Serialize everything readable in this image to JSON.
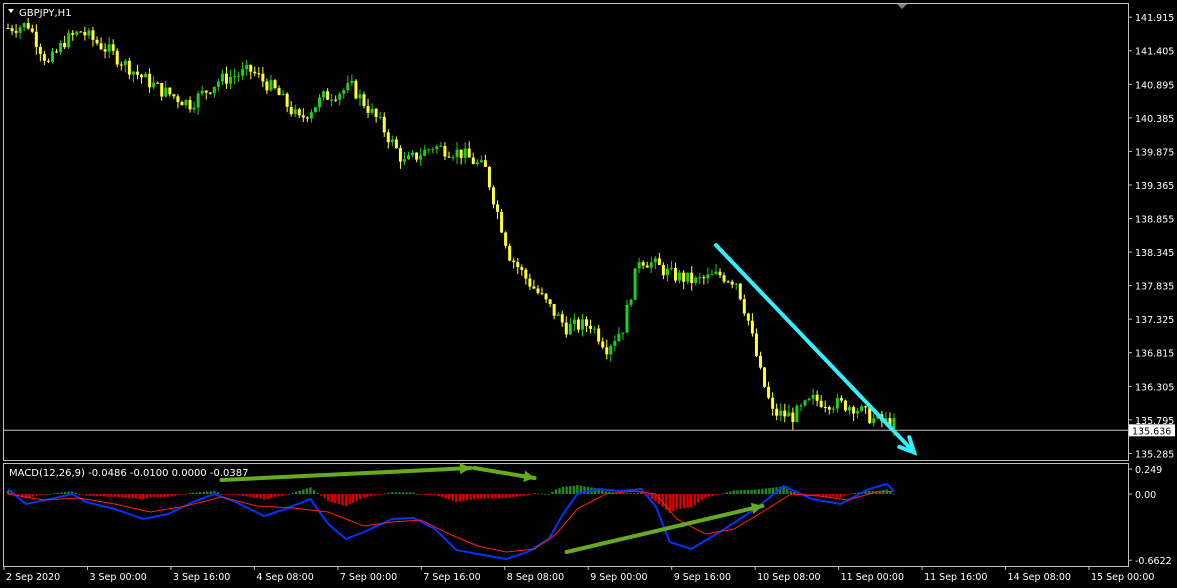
{
  "window": {
    "symbol_title": "GBPJPY,H1",
    "current_price_label": "135.636"
  },
  "colors": {
    "background": "#000000",
    "bull_candle": "#22cc22",
    "bear_candle": "#ffff33",
    "grid_frame": "#c0c0c0",
    "price_line": "#c0c0c0",
    "macd_line": "#0033ff",
    "signal_line": "#ff2200",
    "osma_positive": "#1f8a1f",
    "osma_negative": "#dd0000",
    "trend_arrow": "#33eeff",
    "divergence_arrows": "#66aa22"
  },
  "chart_data": [
    {
      "type": "candlestick",
      "symbol": "GBPJPY",
      "timeframe": "H1",
      "y_ticks": [
        "141.915",
        "141.405",
        "140.895",
        "140.385",
        "139.875",
        "139.365",
        "138.855",
        "138.345",
        "137.835",
        "137.325",
        "136.815",
        "136.305",
        "135.795",
        "135.285"
      ],
      "ylim": [
        135.2,
        142.1
      ],
      "last_price": 135.636,
      "x_ticks": [
        "2 Sep 2020",
        "3 Sep 00:00",
        "3 Sep 16:00",
        "4 Sep 08:00",
        "7 Sep 00:00",
        "7 Sep 16:00",
        "8 Sep 08:00",
        "9 Sep 00:00",
        "9 Sep 16:00",
        "10 Sep 08:00",
        "11 Sep 00:00",
        "11 Sep 16:00",
        "14 Sep 08:00",
        "15 Sep 00:00"
      ],
      "bar_count": 220,
      "close_path": [
        [
          0,
          141.75
        ],
        [
          5,
          141.8
        ],
        [
          10,
          141.2
        ],
        [
          14,
          141.55
        ],
        [
          18,
          141.7
        ],
        [
          25,
          141.4
        ],
        [
          32,
          141.05
        ],
        [
          38,
          140.8
        ],
        [
          45,
          140.6
        ],
        [
          52,
          140.95
        ],
        [
          60,
          141.1
        ],
        [
          66,
          140.8
        ],
        [
          72,
          140.35
        ],
        [
          78,
          140.7
        ],
        [
          85,
          140.85
        ],
        [
          92,
          140.3
        ],
        [
          98,
          139.7
        ],
        [
          105,
          139.95
        ],
        [
          112,
          139.85
        ],
        [
          118,
          139.6
        ],
        [
          124,
          138.3
        ],
        [
          128,
          137.95
        ],
        [
          132,
          137.65
        ],
        [
          138,
          137.2
        ],
        [
          144,
          137.25
        ],
        [
          148,
          136.9
        ],
        [
          152,
          137.2
        ],
        [
          156,
          138.25
        ],
        [
          160,
          138.15
        ],
        [
          164,
          138.0
        ],
        [
          170,
          137.9
        ],
        [
          176,
          138.0
        ],
        [
          180,
          137.9
        ],
        [
          183,
          137.3
        ],
        [
          186,
          136.5
        ],
        [
          189,
          135.9
        ],
        [
          194,
          135.85
        ],
        [
          199,
          136.1
        ],
        [
          204,
          136.05
        ],
        [
          209,
          136.0
        ],
        [
          214,
          135.8
        ],
        [
          218,
          135.75
        ],
        [
          220,
          135.7
        ]
      ],
      "annotations": [
        {
          "type": "arrow",
          "color": "cyan",
          "from": [
            175,
            138.45
          ],
          "to": [
            224,
            135.3
          ]
        }
      ]
    },
    {
      "type": "line",
      "title": "MACD(12,26,9) -0.0486 -0.0100 0.0000 -0.0387",
      "y_ticks": [
        "0.249",
        "0.00",
        "-0.6622"
      ],
      "ylim": [
        -0.7,
        0.28
      ],
      "series": [
        {
          "role": "macd",
          "points": [
            [
              0,
              0.05
            ],
            [
              5,
              -0.1
            ],
            [
              12,
              -0.05
            ],
            [
              18,
              0.0
            ],
            [
              22,
              -0.08
            ],
            [
              30,
              -0.15
            ],
            [
              38,
              -0.25
            ],
            [
              45,
              -0.2
            ],
            [
              52,
              -0.08
            ],
            [
              58,
              0.0
            ],
            [
              64,
              -0.08
            ],
            [
              72,
              -0.22
            ],
            [
              78,
              -0.15
            ],
            [
              85,
              -0.05
            ],
            [
              90,
              -0.3
            ],
            [
              95,
              -0.45
            ],
            [
              100,
              -0.38
            ],
            [
              108,
              -0.25
            ],
            [
              114,
              -0.24
            ],
            [
              120,
              -0.35
            ],
            [
              126,
              -0.56
            ],
            [
              132,
              -0.6
            ],
            [
              140,
              -0.65
            ],
            [
              146,
              -0.58
            ],
            [
              152,
              -0.45
            ],
            [
              156,
              -0.2
            ],
            [
              160,
              0.0
            ],
            [
              166,
              0.05
            ],
            [
              172,
              0.03
            ],
            [
              178,
              0.05
            ],
            [
              182,
              -0.12
            ],
            [
              186,
              -0.48
            ],
            [
              192,
              -0.55
            ],
            [
              200,
              -0.38
            ],
            [
              210,
              -0.15
            ],
            [
              218,
              0.08
            ],
            [
              226,
              -0.05
            ],
            [
              234,
              -0.1
            ],
            [
              242,
              0.05
            ],
            [
              247,
              0.1
            ],
            [
              250,
              0.0
            ]
          ]
        },
        {
          "role": "signal",
          "points": [
            [
              0,
              0.0
            ],
            [
              10,
              -0.06
            ],
            [
              20,
              -0.04
            ],
            [
              30,
              -0.1
            ],
            [
              40,
              -0.18
            ],
            [
              50,
              -0.12
            ],
            [
              60,
              -0.03
            ],
            [
              70,
              -0.12
            ],
            [
              80,
              -0.14
            ],
            [
              90,
              -0.18
            ],
            [
              100,
              -0.32
            ],
            [
              108,
              -0.28
            ],
            [
              116,
              -0.26
            ],
            [
              124,
              -0.4
            ],
            [
              132,
              -0.52
            ],
            [
              140,
              -0.58
            ],
            [
              148,
              -0.55
            ],
            [
              154,
              -0.4
            ],
            [
              160,
              -0.15
            ],
            [
              168,
              0.0
            ],
            [
              176,
              0.03
            ],
            [
              182,
              0.0
            ],
            [
              188,
              -0.25
            ],
            [
              196,
              -0.4
            ],
            [
              204,
              -0.35
            ],
            [
              212,
              -0.18
            ],
            [
              220,
              0.0
            ],
            [
              228,
              -0.02
            ],
            [
              236,
              -0.06
            ],
            [
              244,
              0.02
            ],
            [
              250,
              0.03
            ]
          ]
        }
      ],
      "annotations": [
        {
          "type": "arrow",
          "color": "green",
          "from": [
            60,
            0.14
          ],
          "to": [
            130,
            0.26
          ]
        },
        {
          "type": "arrow",
          "color": "green",
          "from": [
            131,
            0.26
          ],
          "to": [
            148,
            0.16
          ]
        },
        {
          "type": "arrow",
          "color": "green",
          "from": [
            157,
            -0.58
          ],
          "to": [
            212,
            -0.12
          ]
        }
      ]
    }
  ]
}
